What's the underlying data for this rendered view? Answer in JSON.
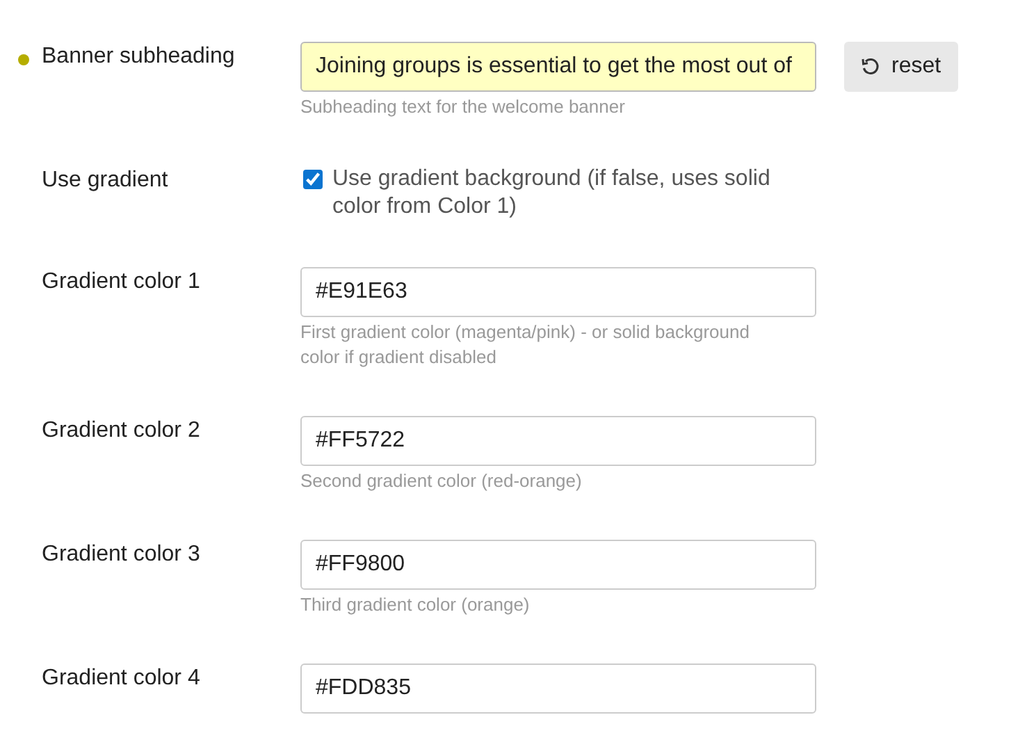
{
  "settings": [
    {
      "kind": "text",
      "label": "Banner subheading",
      "value": "Joining groups is essential to get the most out of",
      "modified": true,
      "reset": "reset",
      "help": "Subheading text for the welcome banner"
    },
    {
      "kind": "checkbox",
      "label": "Use gradient",
      "checked": true,
      "text": "Use gradient background (if false, uses solid color from Color 1)",
      "modified": false
    },
    {
      "kind": "text",
      "label": "Gradient color 1",
      "value": "#E91E63",
      "modified": false,
      "help": "First gradient color (magenta/pink) - or solid background color if gradient disabled"
    },
    {
      "kind": "text",
      "label": "Gradient color 2",
      "value": "#FF5722",
      "modified": false,
      "help": "Second gradient color (red-orange)"
    },
    {
      "kind": "text",
      "label": "Gradient color 3",
      "value": "#FF9800",
      "modified": false,
      "help": "Third gradient color (orange)"
    },
    {
      "kind": "text",
      "label": "Gradient color 4",
      "value": "#FDD835",
      "modified": false
    }
  ]
}
